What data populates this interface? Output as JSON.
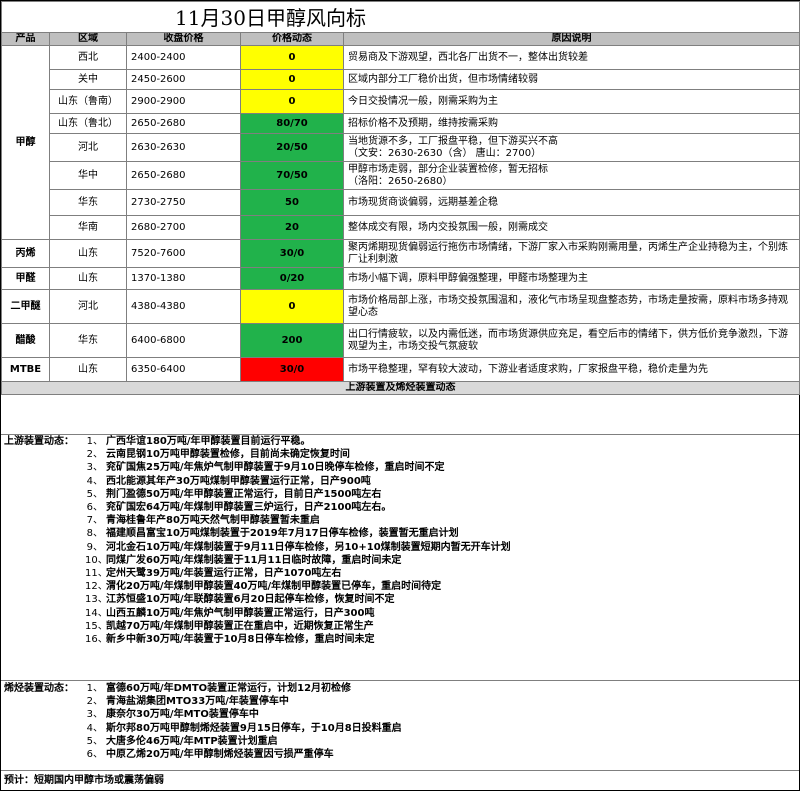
{
  "title": "11月30日甲醇风向标",
  "headers": [
    "产品",
    "区域",
    "收盘价格",
    "价格动态",
    "原因说明"
  ],
  "rows": [
    {
      "product": "甲醇",
      "region": "西北",
      "price": "2400-2400",
      "move": "0",
      "color": "yellow",
      "reason": "贸易商及下游观望，西北各厂出货不一，整体出货较差"
    },
    {
      "product": "",
      "region": "关中",
      "price": "2450-2600",
      "move": "0",
      "color": "yellow",
      "reason": "区域内部分工厂稳价出货，但市场情绪较弱"
    },
    {
      "product": "",
      "region": "山东（鲁南）",
      "price": "2900-2900",
      "move": "0",
      "color": "yellow",
      "reason": "今日交投情况一般，刚需采购为主"
    },
    {
      "product": "",
      "region": "山东（鲁北）",
      "price": "2650-2680",
      "move": "80/70",
      "color": "green",
      "reason": "招标价格不及预期，维持按需采购"
    },
    {
      "product": "",
      "region": "河北",
      "price": "2630-2630",
      "move": "20/50",
      "color": "green",
      "reason": "当地货源不多，工厂报盘平稳，但下游买兴不高\n（文安：2630-2630（含）  唐山：2700）"
    },
    {
      "product": "",
      "region": "华中",
      "price": "2650-2680",
      "move": "70/50",
      "color": "green",
      "reason": "甲醇市场走弱，部分企业装置检修，暂无招标\n（洛阳：2650-2680）"
    },
    {
      "product": "",
      "region": "华东",
      "price": "2730-2750",
      "move": "50",
      "color": "green",
      "reason": "市场现货商谈偏弱，远期基差企稳"
    },
    {
      "product": "",
      "region": "华南",
      "price": "2680-2700",
      "move": "20",
      "color": "green",
      "reason": "整体成交有限，场内交投氛围一般，刚需成交"
    },
    {
      "product": "丙烯",
      "region": "山东",
      "price": "7520-7600",
      "move": "30/0",
      "color": "green",
      "reason": "聚丙烯期现货偏弱运行拖伤市场情绪，下游厂家入市采购刚需用量，丙烯生产企业持稳为主，个别炼厂让利刺激"
    },
    {
      "product": "甲醛",
      "region": "山东",
      "price": "1370-1380",
      "move": "0/20",
      "color": "green",
      "reason": "市场小幅下调，原料甲醇偏强整理，甲醛市场整理为主"
    },
    {
      "product": "二甲醚",
      "region": "河北",
      "price": "4380-4380",
      "move": "0",
      "color": "yellow",
      "reason": "市场价格局部上涨，市场交投氛围温和，液化气市场呈现盘整态势，市场走量按需，原料市场多持观望心态"
    },
    {
      "product": "醋酸",
      "region": "华东",
      "price": "6400-6800",
      "move": "200",
      "color": "green",
      "reason": "出口行情疲软，以及内需低迷，而市场货源供应充足，看空后市的情绪下，供方低价竞争激烈，下游观望为主，市场交投气氛疲软"
    },
    {
      "product": "MTBE",
      "region": "山东",
      "price": "6350-6400",
      "move": "30/0",
      "color": "red",
      "reason": "市场平稳整理，罕有较大波动，下游业者适度求购，厂家报盘平稳，稳价走量为先"
    }
  ],
  "band_label": "上游装置及烯烃装置动态",
  "upstream": {
    "label": "上游装置动态：",
    "items": [
      "广西华谊180万吨/年甲醇装置目前运行平稳。",
      "云南昆钢10万吨甲醇装置检修，目前尚未确定恢复时间",
      "兖矿国焦25万吨/年焦炉气制甲醇装置于9月10日晚停车检修，重启时间不定",
      "西北能源其年产30万吨煤制甲醇装置运行正常，日产900吨",
      "荆门盈德50万吨/年甲醇装置正常运行，目前日产1500吨左右",
      "兖矿国宏64万吨/年煤制甲醇装置三炉运行，日产2100吨左右。",
      "青海桂鲁年产80万吨天然气制甲醇装置暂未重启",
      "福建顺昌富宝10万吨煤制装置于2019年7月17日停车检修，装置暂无重启计划",
      "河北金石10万吨/年煤制装置于9月11日停车检修，另10+10煤制装置短期内暂无开车计划",
      "同煤广发60万吨/年煤制装置于11月11日临时故障，重启时间未定",
      "定州天鹭39万吨/年装置运行正常，日产1070吨左右",
      "渭化20万吨/年煤制甲醇装置40万吨/年煤制甲醇装置已停车，重启时间待定",
      "江苏恒盛10万吨/年联醇装置6月20日起停车检修，恢复时间不定",
      "山西五麟10万吨/年焦炉气制甲醇装置正常运行，日产300吨",
      "凯越70万吨/年煤制甲醇装置正在重启中，近期恢复正常生产",
      "新乡中新30万吨/年装置于10月8日停车检修，重启时间未定"
    ]
  },
  "olefin": {
    "label": "烯烃装置动态：",
    "items": [
      "富德60万吨/年DMTO装置正常运行，计划12月初检修",
      "青海盐湖集团MTO33万吨/年装置停车中",
      "康奈尔30万吨/年MTO装置停车中",
      "斯尔邦80万吨甲醇制烯烃装置9月15日停车，于10月8日投料重启",
      "大唐多伦46万吨/年MTP装置计划重启",
      "中原乙烯20万吨/年甲醇制烯烃装置因亏损严重停车"
    ]
  },
  "forecast": "预计：短期国内甲醇市场或震荡偏弱",
  "colors": {
    "yellow": "#ffff00",
    "green": "#21b24b",
    "red": "#ff0000",
    "header": "#bfbfbf",
    "band": "#d9d9d9"
  }
}
